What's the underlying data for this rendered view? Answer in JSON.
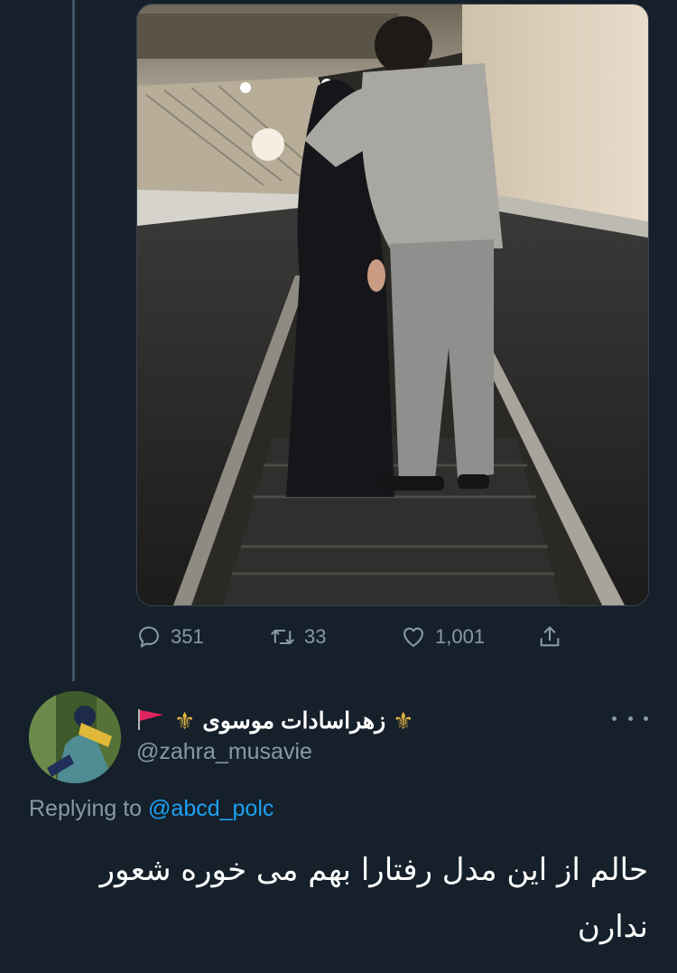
{
  "tweet": {
    "actions": {
      "reply_count": "351",
      "retweet_count": "33",
      "like_count": "1,001",
      "icons": [
        "reply-icon",
        "retweet-icon",
        "like-icon",
        "share-icon"
      ]
    }
  },
  "reply": {
    "display_name": "زهراسادات موسوی",
    "name_decorations": [
      "fleur-de-lis",
      "red-flag"
    ],
    "handle": "@zahra_musavie",
    "replying_prefix": "Replying to",
    "replying_to": "@abcd_polc",
    "text": "حالم از این مدل رفتارا بهم می خوره شعور ندارن"
  },
  "colors": {
    "background": "#15202b",
    "secondary_text": "#8899a6",
    "link": "#1da1f2",
    "fleur": "#e2b441",
    "flag": "#e0245e"
  }
}
